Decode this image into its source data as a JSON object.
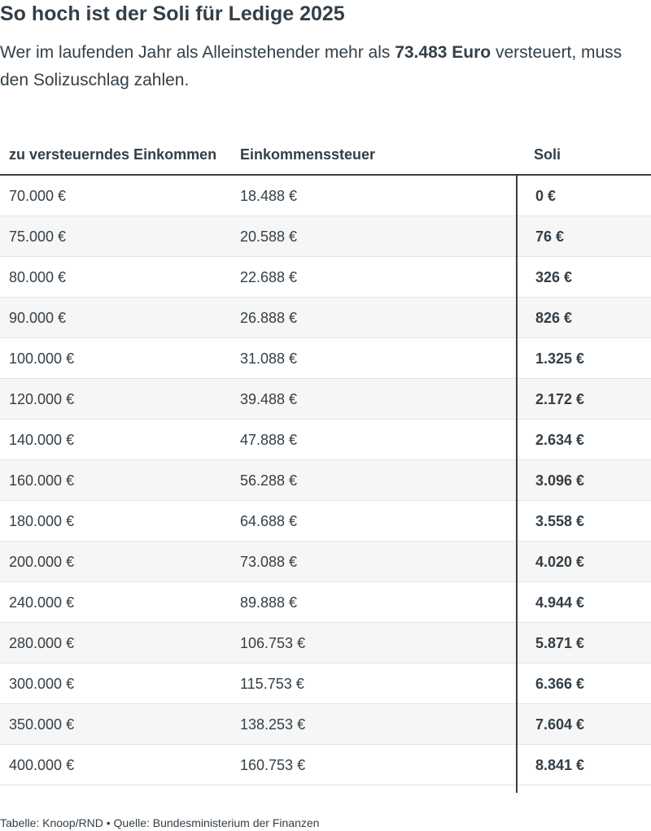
{
  "title": "So hoch ist der Soli für Ledige 2025",
  "subtitle": {
    "before": "Wer im laufenden Jahr als Alleinstehender mehr als ",
    "highlight": "73.483 Euro",
    "after": " versteuert, muss den Solizuschlag zahlen."
  },
  "table": {
    "headers": [
      "zu versteuerndes Einkommen",
      "Einkommenssteuer",
      "Soli"
    ],
    "rows": [
      [
        "70.000 €",
        "18.488 €",
        "0 €"
      ],
      [
        "75.000 €",
        "20.588 €",
        "76 €"
      ],
      [
        "80.000 €",
        "22.688 €",
        "326 €"
      ],
      [
        "90.000 €",
        "26.888 €",
        "826 €"
      ],
      [
        "100.000 €",
        "31.088 €",
        "1.325 €"
      ],
      [
        "120.000 €",
        "39.488 €",
        "2.172 €"
      ],
      [
        "140.000 €",
        "47.888 €",
        "2.634 €"
      ],
      [
        "160.000 €",
        "56.288 €",
        "3.096 €"
      ],
      [
        "180.000 €",
        "64.688 €",
        "3.558 €"
      ],
      [
        "200.000 €",
        "73.088 €",
        "4.020 €"
      ],
      [
        "240.000 €",
        "89.888 €",
        "4.944 €"
      ],
      [
        "280.000 €",
        "106.753 €",
        "5.871 €"
      ],
      [
        "300.000 €",
        "115.753 €",
        "6.366 €"
      ],
      [
        "350.000 €",
        "138.253 €",
        "7.604 €"
      ],
      [
        "400.000 €",
        "160.753 €",
        "8.841 €"
      ]
    ]
  },
  "footer": "Tabelle: Knoop/RND • Quelle: Bundesministerium der Finanzen"
}
